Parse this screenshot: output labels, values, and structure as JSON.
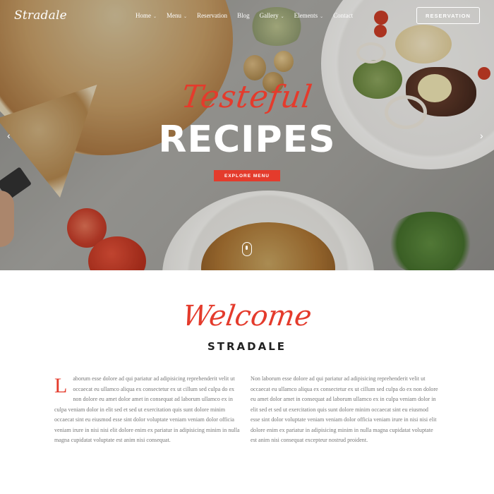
{
  "brand": {
    "logo": "Stradale"
  },
  "nav": {
    "items": [
      {
        "label": "Home",
        "has_dropdown": true
      },
      {
        "label": "Menu",
        "has_dropdown": true
      },
      {
        "label": "Reservation",
        "has_dropdown": false
      },
      {
        "label": "Blog",
        "has_dropdown": false
      },
      {
        "label": "Gallery",
        "has_dropdown": true
      },
      {
        "label": "Elements",
        "has_dropdown": true
      },
      {
        "label": "Contact",
        "has_dropdown": false
      }
    ],
    "reservation_button": "RESERVATION",
    "chevron_glyph": "⌄"
  },
  "hero": {
    "script_title": "Testeful",
    "title": "RECIPES",
    "cta": "EXPLORE MENU",
    "arrow_left": "‹",
    "arrow_right": "›"
  },
  "welcome": {
    "script": "Welcome",
    "subtitle": "STRADALE",
    "dropcap": "L",
    "col_left": "aborum esse dolore ad qui pariatur ad adipisicing reprehenderit velit ut occaecat eu ullamco aliqua ex consectetur ex ut cillum sed culpa do ex non dolore eu amet dolor amet in consequat ad laborum ullamco ex in culpa veniam dolor in elit sed et sed ut exercitation quis sunt dolore minim occaecat sint eu eiusmod esse sint dolor voluptate veniam veniam dolor officia veniam irure in nisi nisi elit dolore enim ex pariatur in adipisicing minim in nulla magna cupidatat voluptate est anim nisi consequat.",
    "col_right": "Non laborum esse dolore ad qui pariatur ad adipisicing reprehenderit velit ut occaecat eu ullamco aliqua ex consectetur ex ut cillum sed culpa do ex non dolore eu amet dolor amet in consequat ad laborum ullamco ex in culpa veniam dolor in elit sed et sed ut exercitation quis sunt dolore minim occaecat sint eu eiusmod esse sint dolor voluptate veniam veniam dolor officia veniam irure in nisi nisi elit dolore enim ex pariatur in adipisicing minim in nulla magna cupidatat voluptate est anim nisi consequat excepteur nostrud proident."
  },
  "colors": {
    "accent": "#e43b2c",
    "text": "#777777",
    "heading": "#222222"
  }
}
